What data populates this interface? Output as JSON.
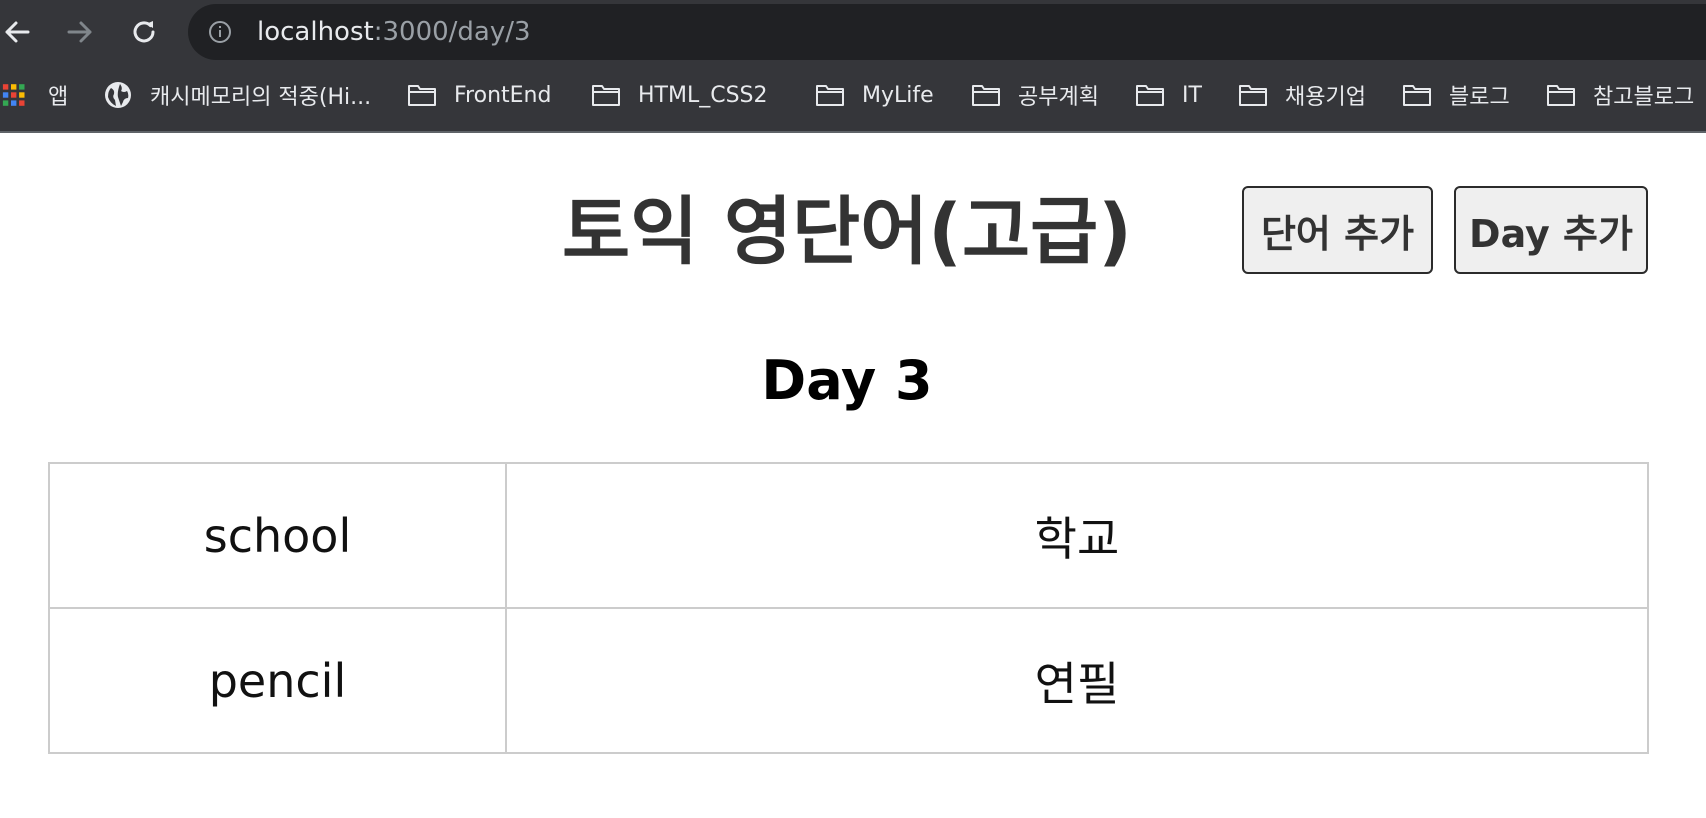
{
  "browser": {
    "url_host": "localhost",
    "url_path": ":3000/day/3",
    "nav": {
      "back_icon": "arrow-left-icon",
      "forward_icon": "arrow-right-icon",
      "reload_icon": "reload-icon",
      "info_icon": "info-icon"
    },
    "bookmarks": [
      {
        "label": "앱",
        "icon": "apps-grid-icon"
      },
      {
        "label": "캐시메모리의 적중(Hi...",
        "icon": "globe-icon"
      },
      {
        "label": "FrontEnd",
        "icon": "folder-icon"
      },
      {
        "label": "HTML_CSS2",
        "icon": "folder-icon"
      },
      {
        "label": "MyLife",
        "icon": "folder-icon"
      },
      {
        "label": "공부계획",
        "icon": "folder-icon"
      },
      {
        "label": "IT",
        "icon": "folder-icon"
      },
      {
        "label": "채용기업",
        "icon": "folder-icon"
      },
      {
        "label": "블로그",
        "icon": "folder-icon"
      },
      {
        "label": "참고블로그",
        "icon": "folder-icon"
      }
    ]
  },
  "header": {
    "title": "토익 영단어(고급)",
    "add_word_label": "단어 추가",
    "add_day_label": "Day 추가"
  },
  "main": {
    "day_heading": "Day 3",
    "words": [
      {
        "eng": "school",
        "kor": "학교"
      },
      {
        "eng": "pencil",
        "kor": "연필"
      }
    ]
  },
  "colors": {
    "chrome_bg": "#35363a",
    "omnibox_bg": "#202124",
    "title_text": "#333333",
    "button_bg": "#efefef",
    "table_border": "#cccccc"
  }
}
